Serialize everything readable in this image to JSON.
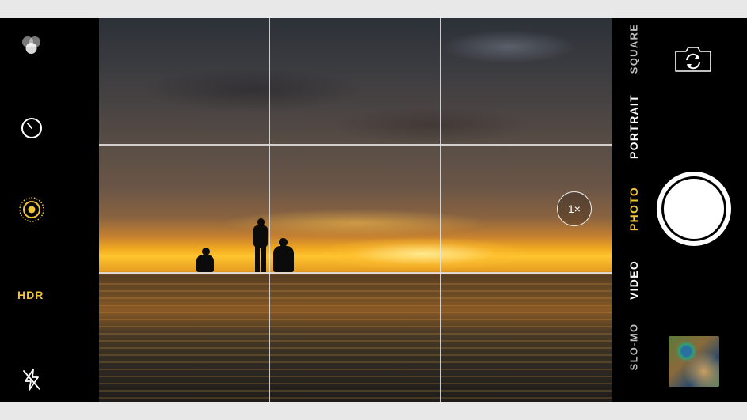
{
  "camera": {
    "left_bar": {
      "filters_icon": "filters-icon",
      "timer_icon": "timer-icon",
      "live_photo_icon": "live-photo-icon",
      "hdr_label": "HDR",
      "flash_icon": "flash-off-icon"
    },
    "viewfinder": {
      "zoom_label": "1×",
      "grid": "on"
    },
    "right_bar": {
      "switch_camera_icon": "switch-camera-icon",
      "modes": [
        "SQUARE",
        "PORTRAIT",
        "PHOTO",
        "VIDEO",
        "SLO-MO"
      ],
      "active_mode": "PHOTO",
      "shutter_icon": "shutter-button",
      "thumbnail": "last-photo-thumbnail"
    },
    "colors": {
      "accent": "#f2c43a",
      "background": "#000000"
    }
  }
}
